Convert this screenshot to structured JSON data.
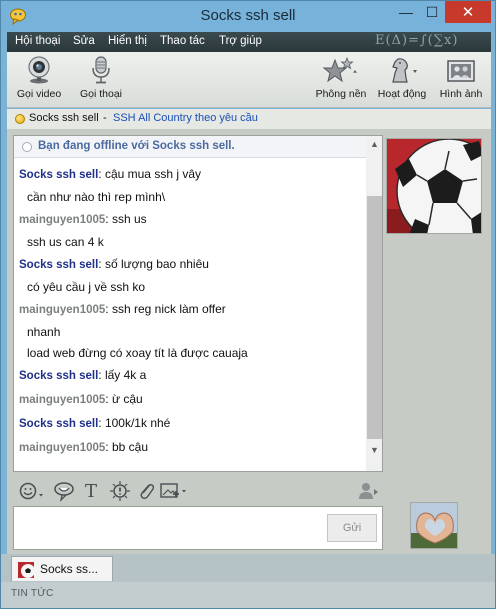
{
  "window": {
    "title": "Socks ssh sell",
    "minimize": "—",
    "maximize": "☐",
    "close": "✕"
  },
  "menu": {
    "items": [
      "Hội thoại",
      "Sửa",
      "Hiển thị",
      "Thao tác",
      "Trợ giúp"
    ],
    "decoration": "E(Δ)=∫(∑x)"
  },
  "toolbar": {
    "video_call": "Gọi video",
    "voice_call": "Gọi thoại",
    "background": "Phông nền",
    "activities": "Hoạt động",
    "photos": "Hình ảnh"
  },
  "status": {
    "contact_name": "Socks ssh sell",
    "separator": "-",
    "message": "SSH All Country theo yêu cầu",
    "status_color": "#f2b600"
  },
  "chat": {
    "offline_notice": "Bạn đang offline với Socks ssh sell.",
    "messages": [
      {
        "sender": "Socks ssh sell",
        "role": "seller",
        "lines": [
          "cậu mua ssh j vây",
          "cần như nào thì rep mình\\"
        ]
      },
      {
        "sender": "mainguyen1005",
        "role": "buyer",
        "lines": [
          "ssh us",
          "ssh us can 4 k"
        ]
      },
      {
        "sender": "Socks ssh sell",
        "role": "seller",
        "lines": [
          "số lượng bao nhiêu",
          "có yêu cầu j về ssh ko"
        ]
      },
      {
        "sender": "mainguyen1005",
        "role": "buyer",
        "lines": [
          "ssh reg nick làm offer",
          "nhanh",
          "load web đừng có xoay tít là được cauaja"
        ]
      },
      {
        "sender": "Socks ssh sell",
        "role": "seller",
        "lines": [
          "lấy 4k a"
        ]
      },
      {
        "sender": "mainguyen1005",
        "role": "buyer",
        "lines": [
          "ừ cậu"
        ]
      },
      {
        "sender": "Socks ssh sell",
        "role": "seller",
        "lines": [
          "100k/1k nhé"
        ]
      },
      {
        "sender": "mainguyen1005",
        "role": "buyer",
        "lines": [
          "bb cậu"
        ]
      }
    ]
  },
  "composer": {
    "text": "",
    "send_label": "Gửi"
  },
  "tab": {
    "label": "Socks ss..."
  },
  "footer": {
    "news_label": "TIN TỨC"
  },
  "colors": {
    "seller_name": "#1f2f8a",
    "buyer_name": "#7b7f7f",
    "status_link": "#1a4fb5",
    "menubar": "#2f3d40",
    "close_button": "#c7392b"
  },
  "icons": {
    "app": "messenger-icon",
    "video_call": "webcam-icon",
    "voice_call": "microphone-icon",
    "background": "stars-icon",
    "activities": "chess-knight-icon",
    "photos": "photos-icon",
    "editor": [
      "emoticon-icon",
      "wink-icon",
      "font-icon",
      "nudge-icon",
      "attach-icon",
      "image-icon",
      "contact-icon"
    ]
  }
}
